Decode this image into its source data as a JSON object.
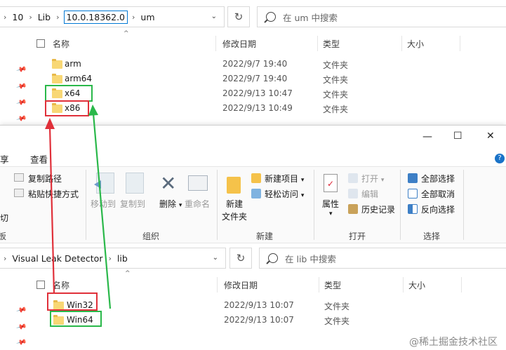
{
  "top": {
    "breadcrumbs": [
      "10",
      "Lib",
      "10.0.18362.0",
      "um"
    ],
    "search_placeholder": "在 um 中搜索",
    "columns": {
      "name": "名称",
      "modified": "修改日期",
      "type": "类型",
      "size": "大小"
    },
    "rows": [
      {
        "name": "arm",
        "modified": "2022/9/7 19:40",
        "type": "文件夹"
      },
      {
        "name": "arm64",
        "modified": "2022/9/7 19:40",
        "type": "文件夹"
      },
      {
        "name": "x64",
        "modified": "2022/9/13 10:47",
        "type": "文件夹"
      },
      {
        "name": "x86",
        "modified": "2022/9/13 10:49",
        "type": "文件夹"
      }
    ]
  },
  "bottom": {
    "window_controls": {
      "minimize": "—",
      "maximize": "☐",
      "close": "✕"
    },
    "tabs": {
      "share_partial": "享",
      "view": "查看"
    },
    "ribbon": {
      "clipboard": {
        "copy_path": "复制路径",
        "paste_shortcut": "粘贴快捷方式",
        "cut_partial": "剪切",
        "group_partial": "板"
      },
      "organize": {
        "move_to": "移动到",
        "copy_to": "复制到",
        "delete": "删除",
        "rename": "重命名",
        "group": "组织"
      },
      "new": {
        "new_folder_line1": "新建",
        "new_folder_line2": "文件夹",
        "new_item": "新建项目",
        "easy_access": "轻松访问",
        "group": "新建"
      },
      "open": {
        "properties": "属性",
        "open": "打开",
        "edit": "编辑",
        "history": "历史记录",
        "group": "打开"
      },
      "select": {
        "select_all": "全部选择",
        "select_none": "全部取消",
        "invert": "反向选择",
        "group": "选择"
      }
    },
    "breadcrumbs": [
      "Visual Leak Detector",
      "lib"
    ],
    "search_placeholder": "在 lib 中搜索",
    "columns": {
      "name": "名称",
      "modified": "修改日期",
      "type": "类型",
      "size": "大小"
    },
    "rows": [
      {
        "name": "Win32",
        "modified": "2022/9/13 10:07",
        "type": "文件夹"
      },
      {
        "name": "Win64",
        "modified": "2022/9/13 10:07",
        "type": "文件夹"
      }
    ]
  },
  "watermark": "@稀土掘金技术社区",
  "colors": {
    "red": "#e0303a",
    "green": "#2ab84a",
    "folder": "#f8d775",
    "accent": "#0078d4"
  }
}
